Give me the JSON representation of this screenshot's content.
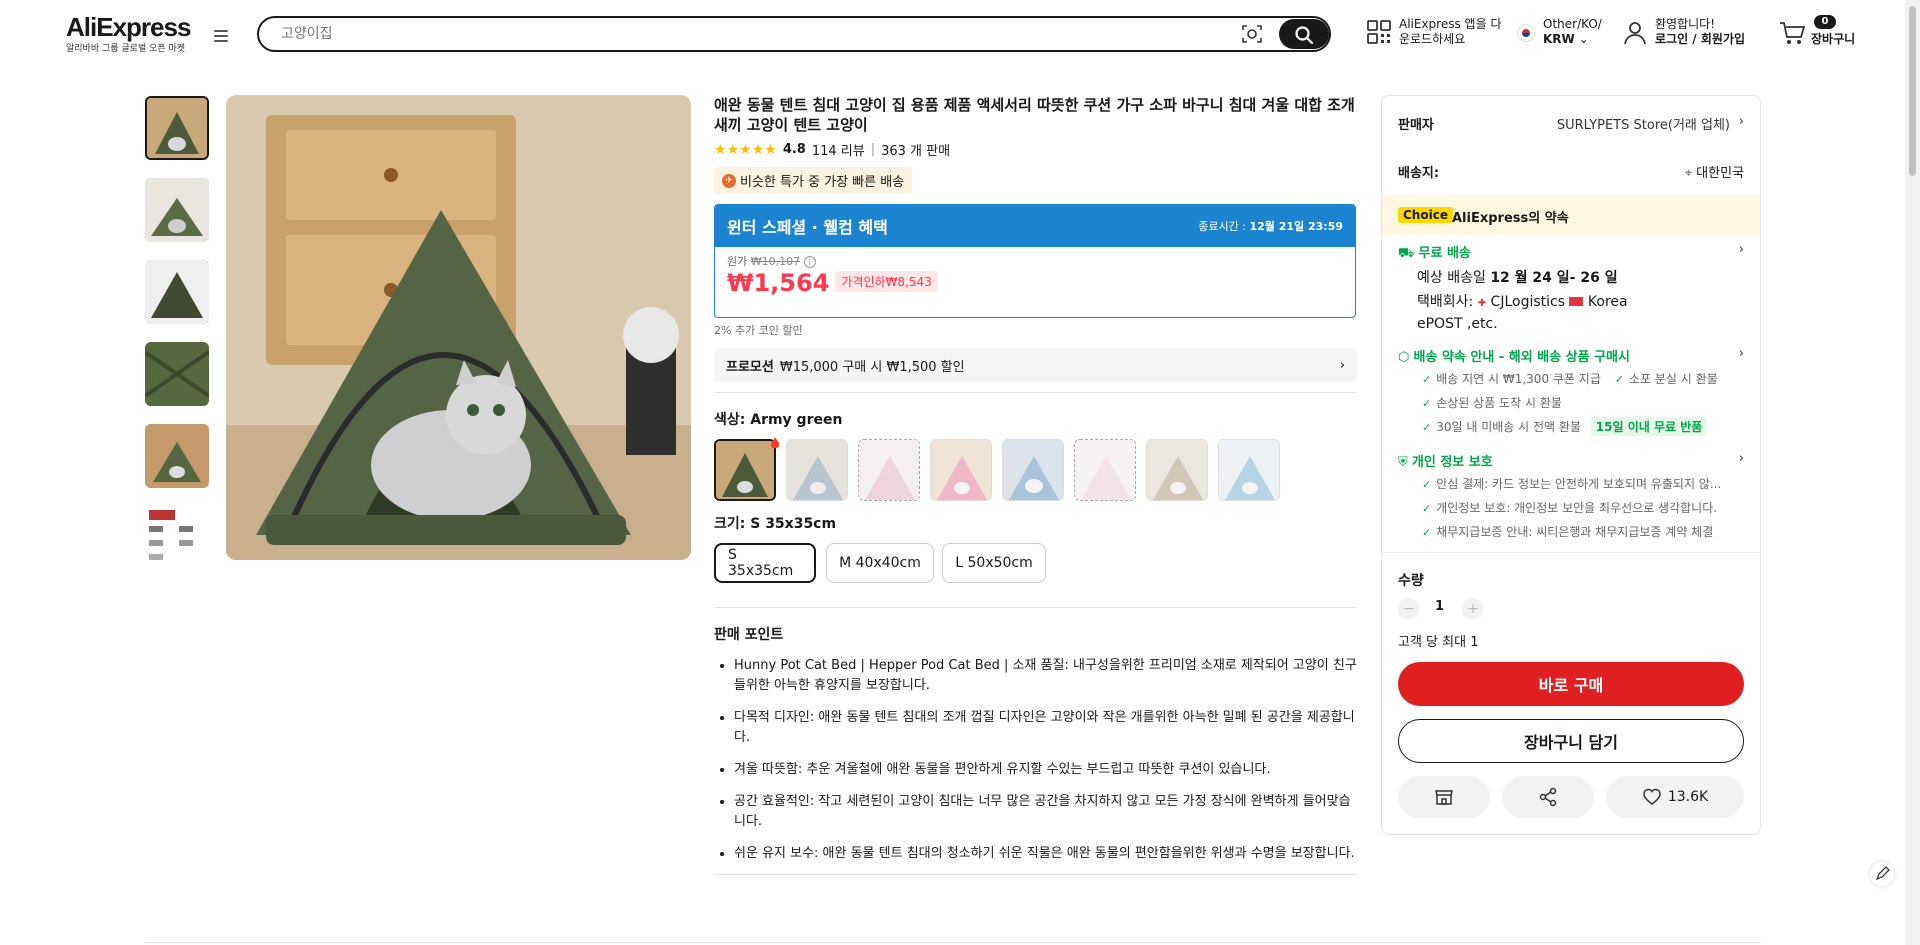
{
  "header": {
    "logo": "AliExpress",
    "logo_sub": "알리바바 그룹 글로벌 오픈 마켓",
    "search_placeholder": "고양이집",
    "app_line1": "AliExpress 앱을 다",
    "app_line2": "운로드하세요",
    "locale_line1": "Other/KO/",
    "locale_line2": "KRW",
    "account_line1": "환영합니다!",
    "account_line2": "로그인 / 회원가입",
    "cart_count": "0",
    "cart_label": "장바구니"
  },
  "product": {
    "title": "애완 동물 텐트 침대 고양이 집 용품 제품 액세서리 따뜻한 쿠션 가구 소파 바구니 침대 겨울 대합 조개 새끼 고양이 텐트 고양이",
    "rating": "4.8",
    "reviews": "114 리뷰",
    "sold": "363 개 판매",
    "fast_tag": "비슷한 특가 중 가장 빠른 배송",
    "promo_title": "윈터 스페셜 · 웰컴 혜택",
    "promo_end_label": "종료시간 :",
    "promo_end_value": "12월 21일 23:59",
    "original_label": "원가",
    "original_price": "₩10,107",
    "price": "₩1,564",
    "discount": "가격인하₩8,543",
    "coin_note": "2% 추가 코인 할인",
    "promotion_label": "프로모션",
    "promotion_text": "₩15,000 구매 시 ₩1,500 할인",
    "color_label": "색상: Army green",
    "size_label": "크기: S 35x35cm",
    "sizes": [
      "S 35x35cm",
      "M 40x40cm",
      "L 50x50cm"
    ],
    "points_title": "판매 포인트",
    "points": [
      "Hunny Pot Cat Bed | Hepper Pod Cat Bed | 소재 품질: 내구성을위한 프리미엄 소재로 제작되어 고양이 친구들위한 아늑한 휴양지를 보장합니다.",
      "다목적 디자인: 애완 동물 텐트 침대의 조개 껍질 디자인은 고양이와 작은 개를위한 아늑한 밀폐 된 공간을 제공합니다.",
      "겨울 따뜻함: 추운 겨울철에 애완 동물을 편안하게 유지할 수있는 부드럽고 따뜻한 쿠션이 있습니다.",
      "공간 효율적인: 작고 세련된이 고양이 침대는 너무 많은 공간을 차지하지 않고 모든 가정 장식에 완벽하게 들어맞습니다.",
      "쉬운 유지 보수: 애완 동물 텐트 침대의 청소하기 쉬운 직물은 애완 동물의 편안함을위한 위생과 수명을 보장합니다."
    ]
  },
  "panel": {
    "seller_label": "판매자",
    "seller_name": "SURLYPETS Store(거래 업체)",
    "ship_to_label": "배송지:",
    "ship_to_value": "대한민국",
    "choice_tag": "Choice",
    "choice_text": "AliExpress의 약속",
    "free_ship": "무료 배송",
    "eta_prefix": "예상 배송일",
    "eta_value": "12 월 24 일- 26 일",
    "carrier_prefix": "택배회사:",
    "carrier_1": "CJLogistics",
    "carrier_2": "Korea",
    "carrier_3": "ePOST ,etc.",
    "guarantee_title": "배송 약속 안내 - 해외 배송 상품 구매시",
    "guarantee_1": "배송 지연 시 ₩1,300 쿠폰 지급",
    "guarantee_2": "소포 분실 시 환불",
    "guarantee_3": "손상된 상품 도착 시 환불",
    "guarantee_4": "30일 내 미배송 시 전액 환불",
    "guarantee_badge": "15일 이내 무료 반품",
    "privacy_title": "개인 정보 보호",
    "privacy_1": "안심 결제: 카드 정보는 안전하게 보호되며 유출되지 않...",
    "privacy_2": "개인정보 보호: 개인정보 보안을 최우선으로 생각합니다.",
    "privacy_3": "채무지급보증 안내: 씨티은행과 채무지급보증 계약 체결",
    "qty_label": "수량",
    "qty_value": "1",
    "qty_limit": "고객 당 최대 1",
    "buy_now": "바로 구매",
    "add_cart": "장바구니 담기",
    "wishlist_count": "13.6K"
  },
  "colors": {
    "accent_red": "#e02020",
    "price_red": "#fd384f",
    "promo_blue": "#1b84d1",
    "choice_yellow": "#fdd600",
    "green": "#00a64a"
  }
}
